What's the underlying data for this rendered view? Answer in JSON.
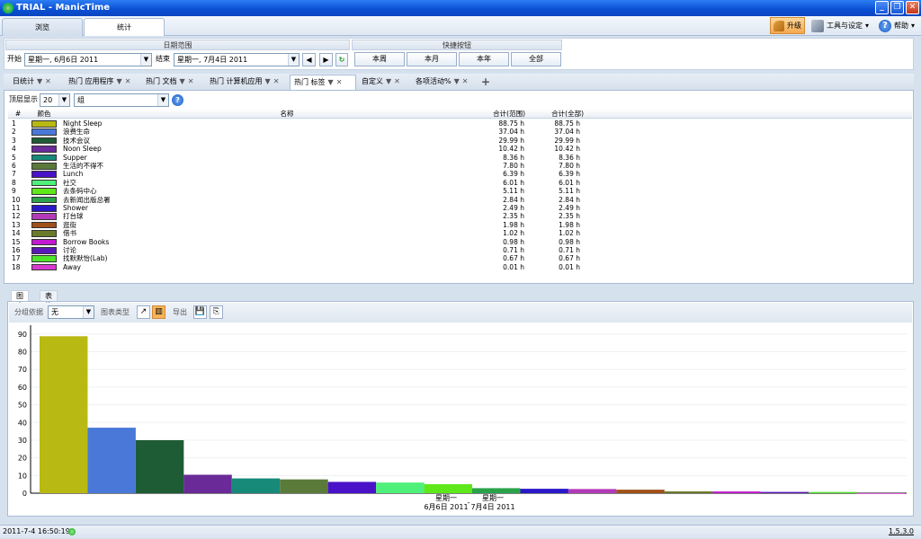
{
  "window": {
    "title": "TRIAL - ManicTime"
  },
  "main_tabs": [
    {
      "label": "浏览"
    },
    {
      "label": "统计"
    }
  ],
  "toolbar": {
    "upgrade": "升级",
    "tools": "工具与设定",
    "help": "帮助"
  },
  "date_range": {
    "header": "日期范围",
    "start_label": "开始",
    "start_value": "星期一, 6月6日 2011",
    "end_label": "结束",
    "end_value": "星期一, 7月4日 2011"
  },
  "quick": {
    "header": "快捷按钮",
    "buttons": [
      "本周",
      "本月",
      "本年",
      "全部"
    ]
  },
  "view_tabs": [
    {
      "label": "日统计"
    },
    {
      "label": "热门 应用程序"
    },
    {
      "label": "热门 文档"
    },
    {
      "label": "热门 计算机应用"
    },
    {
      "label": "热门 标签"
    },
    {
      "label": "自定义"
    },
    {
      "label": "各项活动%"
    }
  ],
  "filter": {
    "top_label": "顶层显示",
    "top_value": "20",
    "group_value": "组"
  },
  "table": {
    "headers": {
      "num": "#",
      "color": "颜色",
      "name": "名称",
      "total_range": "合计(范围)",
      "total_all": "合计(全部)"
    },
    "rows": [
      {
        "n": "1",
        "color": "#b9b913",
        "name": "Night Sleep",
        "range": "88.75 h",
        "all": "88.75 h"
      },
      {
        "n": "2",
        "color": "#4a78d8",
        "name": "浪费生命",
        "range": "37.04 h",
        "all": "37.04 h"
      },
      {
        "n": "3",
        "color": "#1e5c36",
        "name": "技术会议",
        "range": "29.99 h",
        "all": "29.99 h"
      },
      {
        "n": "4",
        "color": "#6a2a98",
        "name": "Noon Sleep",
        "range": "10.42 h",
        "all": "10.42 h"
      },
      {
        "n": "5",
        "color": "#178a7a",
        "name": "Supper",
        "range": "8.36 h",
        "all": "8.36 h"
      },
      {
        "n": "6",
        "color": "#5a7a3a",
        "name": "生活的不得不",
        "range": "7.80 h",
        "all": "7.80 h"
      },
      {
        "n": "7",
        "color": "#4a12c8",
        "name": "Lunch",
        "range": "6.39 h",
        "all": "6.39 h"
      },
      {
        "n": "8",
        "color": "#4ff07a",
        "name": "社交",
        "range": "6.01 h",
        "all": "6.01 h"
      },
      {
        "n": "9",
        "color": "#5ee81a",
        "name": "去条码中心",
        "range": "5.11 h",
        "all": "5.11 h"
      },
      {
        "n": "10",
        "color": "#2aa24a",
        "name": "去新闻出版总署",
        "range": "2.84 h",
        "all": "2.84 h"
      },
      {
        "n": "11",
        "color": "#2a18c8",
        "name": "Shower",
        "range": "2.49 h",
        "all": "2.49 h"
      },
      {
        "n": "12",
        "color": "#b23ab8",
        "name": "打台球",
        "range": "2.35 h",
        "all": "2.35 h"
      },
      {
        "n": "13",
        "color": "#a0501a",
        "name": "逛街",
        "range": "1.98 h",
        "all": "1.98 h"
      },
      {
        "n": "14",
        "color": "#6a7a2a",
        "name": "借书",
        "range": "1.02 h",
        "all": "1.02 h"
      },
      {
        "n": "15",
        "color": "#c21ad0",
        "name": "Borrow Books",
        "range": "0.98 h",
        "all": "0.98 h"
      },
      {
        "n": "16",
        "color": "#5a18b8",
        "name": "讨论",
        "range": "0.71 h",
        "all": "0.71 h"
      },
      {
        "n": "17",
        "color": "#4ee42a",
        "name": "找默默怡(Lab)",
        "range": "0.67 h",
        "all": "0.67 h"
      },
      {
        "n": "18",
        "color": "#d838d0",
        "name": "Away",
        "range": "0.01 h",
        "all": "0.01 h"
      }
    ]
  },
  "chart_tabs": [
    {
      "label": "图表"
    },
    {
      "label": "表格"
    }
  ],
  "chart_toolbar": {
    "group_label": "分组依据",
    "group_value": "无",
    "type_label": "图表类型",
    "export_label": "导出"
  },
  "chart_data": {
    "type": "bar",
    "categories": [
      "Night Sleep",
      "浪费生命",
      "技术会议",
      "Noon Sleep",
      "Supper",
      "生活的不得不",
      "Lunch",
      "社交",
      "去条码中心",
      "去新闻出版总署",
      "Shower",
      "打台球",
      "逛街",
      "借书",
      "Borrow Books",
      "讨论",
      "找默默怡(Lab)",
      "Away"
    ],
    "values": [
      88.75,
      37.04,
      29.99,
      10.42,
      8.36,
      7.8,
      6.39,
      6.01,
      5.11,
      2.84,
      2.49,
      2.35,
      1.98,
      1.02,
      0.98,
      0.71,
      0.67,
      0.01
    ],
    "colors": [
      "#b9b913",
      "#4a78d8",
      "#1e5c36",
      "#6a2a98",
      "#178a7a",
      "#5a7a3a",
      "#4a12c8",
      "#4ff07a",
      "#5ee81a",
      "#2aa24a",
      "#2a18c8",
      "#b23ab8",
      "#a0501a",
      "#6a7a2a",
      "#c21ad0",
      "#5a18b8",
      "#4ee42a",
      "#d838d0"
    ],
    "ylim": [
      0,
      95
    ],
    "yticks": [
      "0",
      "10",
      "20",
      "30",
      "40",
      "50",
      "60",
      "70",
      "80",
      "90"
    ],
    "x_labels": [
      {
        "line1": "星期一",
        "line2": "6月6日 2011"
      },
      {
        "line1": "星期一",
        "line2": "7月4日 2011"
      }
    ],
    "x_separator": "-",
    "grid": true
  },
  "status": {
    "datetime": "2011-7-4 16:50:19",
    "version": "1.5.3.0"
  }
}
